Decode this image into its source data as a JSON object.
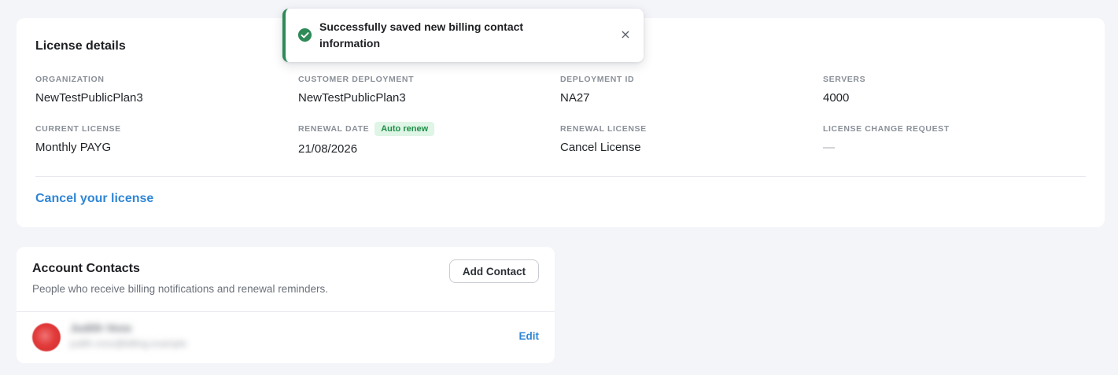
{
  "toast": {
    "message": "Successfully saved new billing contact information",
    "icon": "check-circle-icon",
    "close_icon": "close-icon",
    "close_glyph": "×",
    "accent_color": "#2e8a57"
  },
  "license": {
    "title": "License details",
    "fields": {
      "organization": {
        "label": "ORGANIZATION",
        "value": "NewTestPublicPlan3"
      },
      "customer_deployment": {
        "label": "CUSTOMER DEPLOYMENT",
        "value": "NewTestPublicPlan3"
      },
      "deployment_id": {
        "label": "DEPLOYMENT ID",
        "value": "NA27"
      },
      "servers": {
        "label": "SERVERS",
        "value": "4000"
      },
      "current_license": {
        "label": "CURRENT LICENSE",
        "value": "Monthly PAYG"
      },
      "renewal_date": {
        "label": "RENEWAL DATE",
        "value": "21/08/2026",
        "badge": "Auto renew"
      },
      "renewal_license": {
        "label": "RENEWAL LICENSE",
        "value": "Cancel License"
      },
      "license_change_request": {
        "label": "LICENSE CHANGE REQUEST",
        "value": "—"
      }
    },
    "cancel_link": "Cancel your license",
    "link_color": "#2f86d6"
  },
  "contacts": {
    "title": "Account Contacts",
    "subtitle": "People who receive billing notifications and renewal reminders.",
    "add_button": "Add Contact",
    "items": [
      {
        "name": "Judith Voss",
        "email": "judith.voss@billing.example",
        "edit_label": "Edit",
        "avatar_color": "#e23b3b"
      }
    ]
  }
}
